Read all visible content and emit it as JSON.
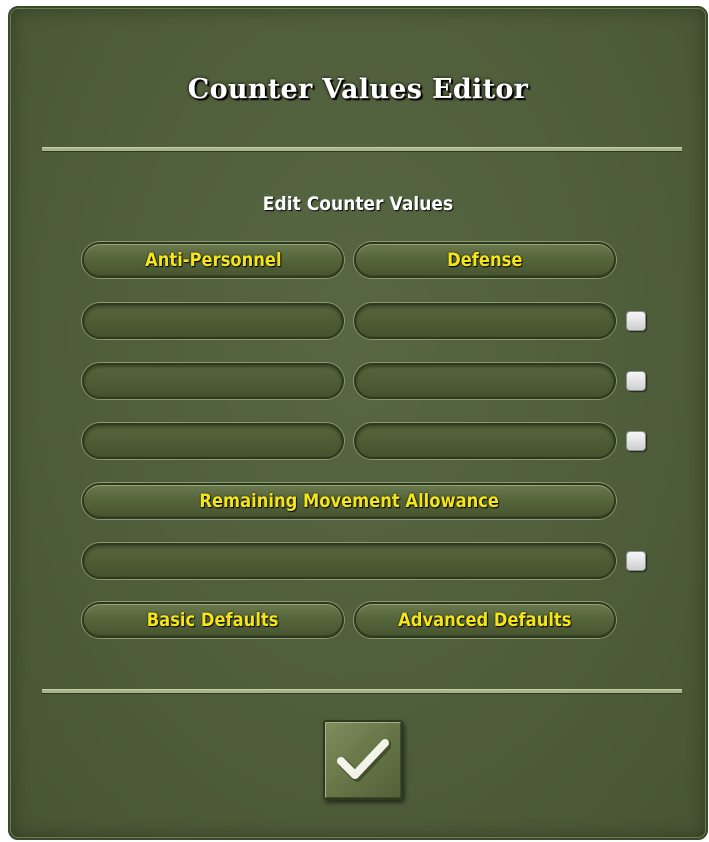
{
  "dialog": {
    "title": "Counter Values Editor"
  },
  "section": {
    "heading": "Edit Counter Values"
  },
  "columns": {
    "anti_personnel_label": "Anti-Personnel",
    "defense_label": "Defense"
  },
  "rows": [
    {
      "anti_personnel_value": "",
      "defense_value": "",
      "checked": false
    },
    {
      "anti_personnel_value": "",
      "defense_value": "",
      "checked": false
    },
    {
      "anti_personnel_value": "",
      "defense_value": "",
      "checked": false
    }
  ],
  "movement": {
    "label": "Remaining Movement Allowance",
    "value": "",
    "checked": false
  },
  "buttons": {
    "basic_defaults": "Basic Defaults",
    "advanced_defaults": "Advanced Defaults",
    "confirm_icon": "checkmark-icon"
  },
  "colors": {
    "panel": "#4f5f39",
    "label_text": "#f4e41a",
    "title_text": "#ffffff"
  }
}
